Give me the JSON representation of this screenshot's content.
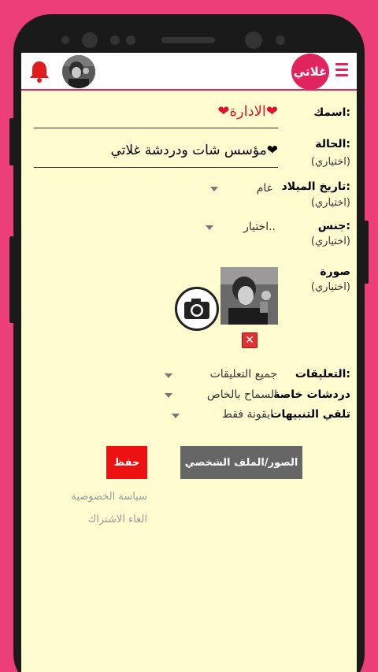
{
  "appbar": {
    "logo_text": "غلاتي",
    "bell_color": "#e01c1c",
    "accent_color": "#e0245e"
  },
  "form": {
    "name": {
      "label": "اسمك:",
      "value": "❤الادارة❤"
    },
    "status": {
      "label": "الحالة:",
      "optional": "(اختياري)",
      "value": "مؤسس شات ودردشة غلاتي❤"
    },
    "birthdate": {
      "label": "تاريخ الميلاد:",
      "optional": "(اختياري)",
      "value": "عام"
    },
    "gender": {
      "label": "جنس:",
      "optional": "(اختياري)",
      "value": "اختيار.."
    },
    "photo": {
      "label": "صورة",
      "optional": "(اختياري)",
      "delete_glyph": "✕"
    },
    "comments": {
      "label": "التعليقات:",
      "value": "جميع التعليقات"
    },
    "private_chats": {
      "label": "دردشات خاصة",
      "value": "السماح بالخاص"
    },
    "notifications": {
      "label": "تلقي التنبيهات",
      "value": "ايقونة فقط"
    }
  },
  "actions": {
    "save_label": "حفظ",
    "photos_label": "الصور/الملف الشخصي",
    "save_color": "#ee1111",
    "photos_color": "#666666"
  },
  "links": {
    "privacy": "سياسة الخصوصية",
    "unsubscribe": "الغاء الاشتراك"
  }
}
